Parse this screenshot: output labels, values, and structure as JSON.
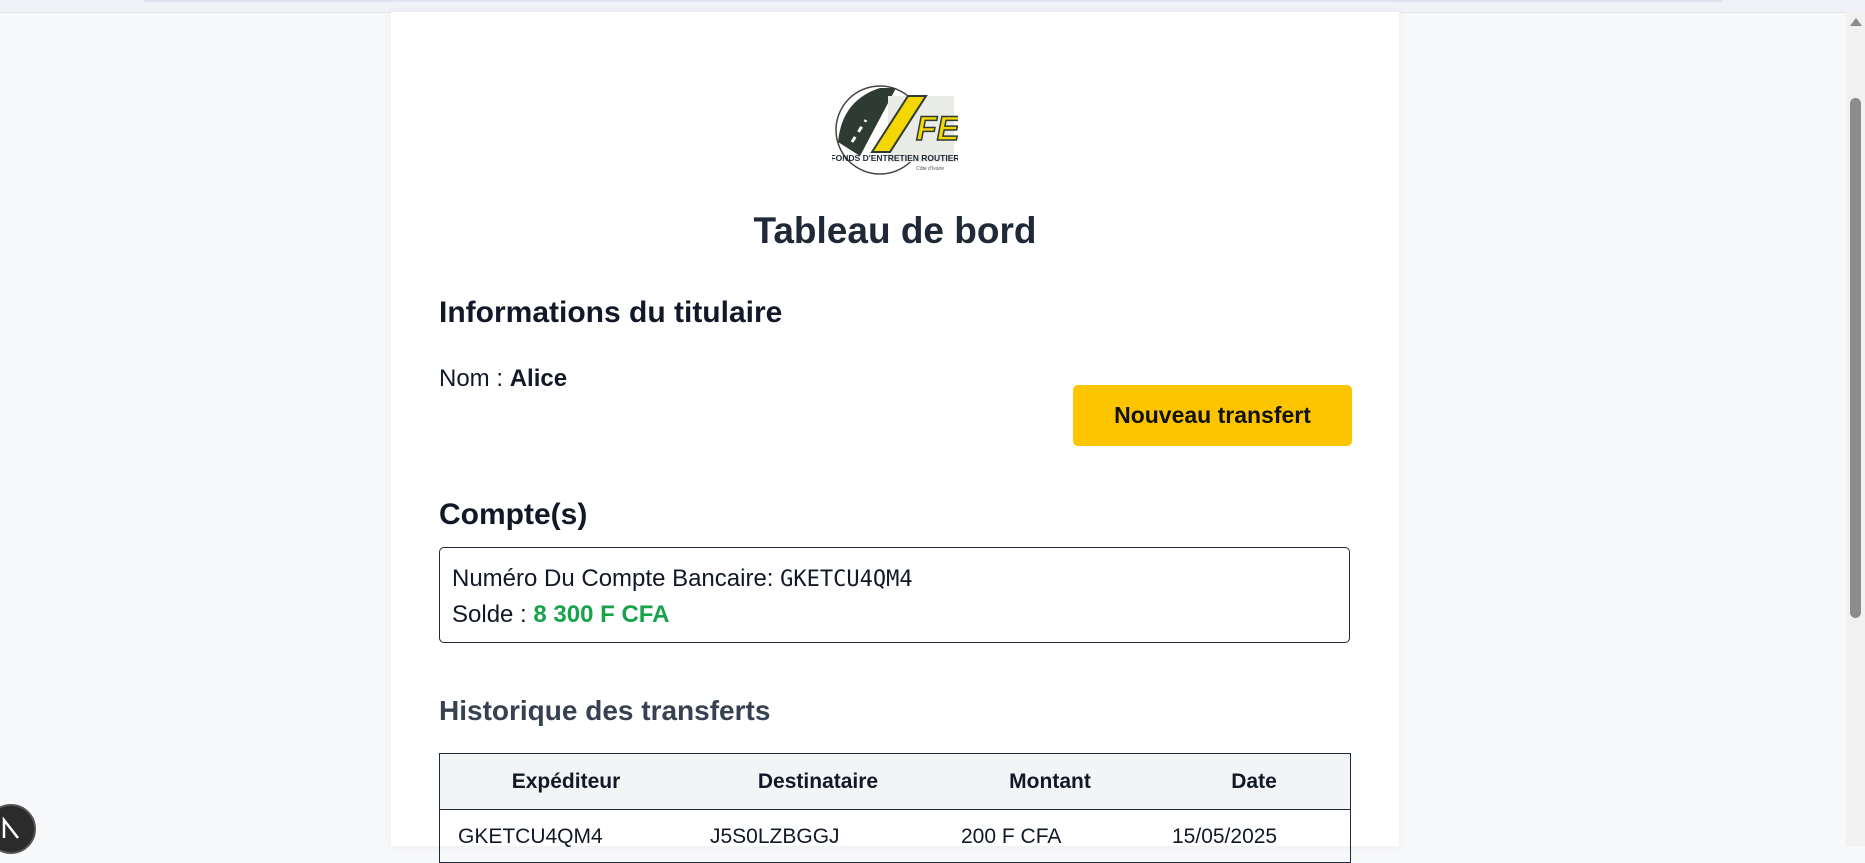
{
  "logo": {
    "letters": "FER",
    "text": "FONDS D'ENTRETIEN ROUTIER",
    "tagline": "Côte d'Ivoire"
  },
  "page": {
    "title": "Tableau de bord"
  },
  "holder": {
    "title": "Informations du titulaire",
    "name_label": "Nom :",
    "name_value": "Alice"
  },
  "actions": {
    "new_transfer": "Nouveau transfert"
  },
  "accounts": {
    "title": "Compte(s)",
    "items": [
      {
        "number_label": "Numéro Du Compte Bancaire:",
        "number": "GKETCU4QM4",
        "balance_label": "Solde :",
        "balance": "8 300 F CFA"
      }
    ]
  },
  "history": {
    "title": "Historique des transferts",
    "columns": [
      "Expéditeur",
      "Destinataire",
      "Montant",
      "Date"
    ],
    "rows": [
      [
        "GKETCU4QM4",
        "J5S0LZBGGJ",
        "200 F CFA",
        "15/05/2025"
      ]
    ]
  },
  "colors": {
    "accent": "#fcc500",
    "balance": "#16a34a",
    "text": "#111827"
  },
  "icons": {
    "scroll_up": "triangle-up-icon",
    "assistant": "n-logo-icon"
  }
}
